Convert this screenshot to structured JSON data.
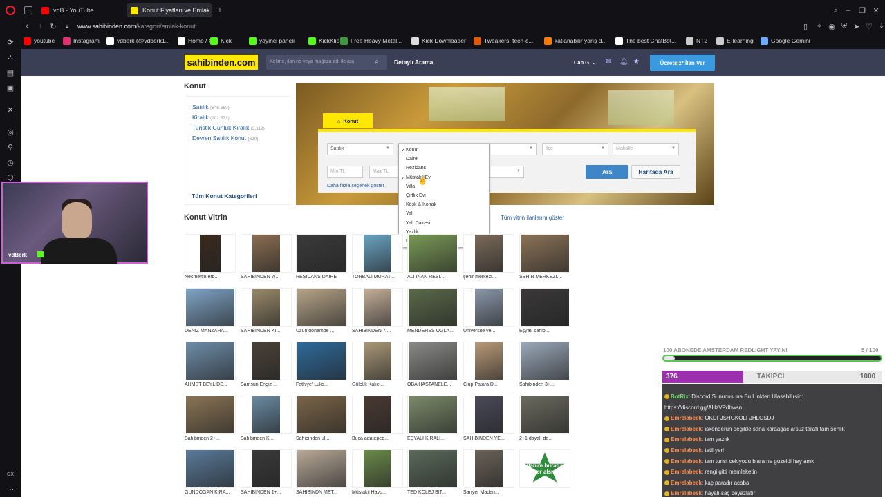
{
  "browser": {
    "tabs": [
      {
        "label": "vdB - YouTube"
      },
      {
        "label": "Konut Fiyatları ve Emlak İla"
      }
    ],
    "new_tab": "+",
    "url_host": "www.sahibinden.com",
    "url_path": "/kategori/emlak-konut",
    "bookmarks": [
      {
        "label": "youtube",
        "icon": "youtube-icon",
        "color": "#ff0000"
      },
      {
        "label": "Instagram",
        "icon": "instagram-icon",
        "color": "#e1306c"
      },
      {
        "label": "vdberk (@vdberk1...",
        "icon": "tiktok-icon",
        "color": "#ffffff"
      },
      {
        "label": "Home / X",
        "icon": "x-icon",
        "color": "#ffffff"
      },
      {
        "label": "Kick",
        "icon": "kick-icon",
        "color": "#53fc18"
      },
      {
        "label": "yayinci paneli",
        "icon": "kick-icon",
        "color": "#53fc18"
      },
      {
        "label": "KickKlip",
        "icon": "kick-icon",
        "color": "#53fc18"
      },
      {
        "label": "Free Heavy Metal...",
        "icon": "music-icon",
        "color": "#3c9a3c"
      },
      {
        "label": "Kick Downloader",
        "icon": "download-icon",
        "color": "#dddddd"
      },
      {
        "label": "Tweakers: tech-c...",
        "icon": "tweakers-icon",
        "color": "#e05a00"
      },
      {
        "label": "katlanabilir yarış d...",
        "icon": "shop-icon",
        "color": "#ff7a00"
      },
      {
        "label": "The best ChatBot...",
        "icon": "chatgpt-icon",
        "color": "#ffffff"
      },
      {
        "label": "NT2",
        "icon": "doc-icon",
        "color": "#cccccc"
      },
      {
        "label": "E-learning",
        "icon": "doc-icon",
        "color": "#cccccc"
      },
      {
        "label": "Google Gemini",
        "icon": "gemini-icon",
        "color": "#6aa9ff"
      }
    ]
  },
  "site": {
    "logo": "sahibinden.com",
    "search_placeholder": "Kelime, ilan no veya mağaza adı ile ara",
    "detailed_search": "Detaylı Arama",
    "user": "Can G.",
    "post_ad": "Ücretsiz* İlan Ver",
    "accent": "#ffe800",
    "header_bg": "#3a3f55"
  },
  "konut": {
    "title": "Konut",
    "categories": [
      {
        "label": "Satılık",
        "count": "(646.660)"
      },
      {
        "label": "Kiralık",
        "count": "(202.571)"
      },
      {
        "label": "Turistik Günlük Kiralık",
        "count": "(3.119)"
      },
      {
        "label": "Devren Satılık Konut",
        "count": "(690)"
      }
    ],
    "all_categories": "Tüm Konut Kategorileri"
  },
  "search_form": {
    "tab": "Konut",
    "type_select": "Satılık",
    "ilce": "İlçe",
    "mahalle": "Mahalle",
    "min_tl": "Min TL",
    "max_tl": "Max TL",
    "more_options": "Daha fazla seçenek göster",
    "search": "Ara",
    "map_search": "Haritada Ara",
    "dropdown_options": [
      {
        "label": "Konut",
        "checked": true
      },
      {
        "label": "Daire",
        "checked": false
      },
      {
        "label": "Rezidans",
        "checked": false
      },
      {
        "label": "Müstakil Ev",
        "checked": true
      },
      {
        "label": "Villa",
        "checked": false
      },
      {
        "label": "Çiftlik Evi",
        "checked": false
      },
      {
        "label": "Köşk & Konak",
        "checked": false
      },
      {
        "label": "Yalı",
        "checked": false
      },
      {
        "label": "Yalı Dairesi",
        "checked": false
      },
      {
        "label": "Yazlık",
        "checked": false
      },
      {
        "label": "Kooperatif",
        "checked": false
      }
    ],
    "check_mark": "✓"
  },
  "vitrin": {
    "title": "Konut Vitrin",
    "show_all": "Tüm vitrin ilanlarını göster",
    "rows": [
      [
        "Necmettin erb...",
        "SAHİBİNDEN 7/...",
        "RESİDANS DAİRE",
        "TORBALI MURAT...",
        "ALİ İNAN RESİ...",
        "şehir merkezi...",
        "ŞEHİR MERKEZİ..."
      ],
      [
        "DENİZ MANZARA...",
        "SAHİBİNDEN Kİ...",
        "Uzun donemde ...",
        "SAHİBİNDEN 7/...",
        "MENDERES OĞLA...",
        "Üniversite ve...",
        "Eşyalı sahibi..."
      ],
      [
        "AHMET BEYLİDE...",
        "Samsun Engiz ...",
        "Fethiye' Luks...",
        "Gölcük Kalıcı...",
        "OBA HASTANELE...",
        "Clup Patara D...",
        "Sahibinden 3+..."
      ],
      [
        "Sahibinden 2+...",
        "Sahibinden Ki...",
        "Sahibinden ul...",
        "Buca adateped...",
        "EŞYALI KİRALI...",
        "SAHİBİNDEN YE...",
        "2+1 dayalı do..."
      ],
      [
        "GÜNDOĞAN KİRA...",
        "SAHİBİNDEN 1+...",
        "SAHİBİNDN MET...",
        "Müstakil Havu...",
        "TED KOLEJ BİT...",
        "Sarıyer Maden...",
        ""
      ]
    ],
    "ad_here": "İlanım burada yer alsın"
  },
  "stream": {
    "streamer": "vdBerk",
    "sub_goal": "100 ABONEDE AMSTERDAM REDLIGHT YAYINI",
    "sub_goal_count": "5 / 100",
    "sub_goal_progress": 0.05,
    "followers_current": "376",
    "followers_label": "TAKIPCI",
    "followers_target": "1000",
    "follower_progress": 0.376,
    "chat": [
      {
        "user": "",
        "text": "",
        "partial": true
      },
      {
        "user": "BotRix",
        "text": ": Discord Sunucusuna Bu Linkten Ulasabilirsin:"
      },
      {
        "user": "",
        "text": "https://discord.gg/AHzVPdbwsn"
      },
      {
        "user": "Emrelabeek",
        "text": ": OKDFJSHGKOLFJHLGSDJ"
      },
      {
        "user": "Emrelabeek",
        "text": ": iskenderun degilde sana karaagac arsuz tarafı tam senlik"
      },
      {
        "user": "Emrelabeek",
        "text": ": tam yazlık"
      },
      {
        "user": "Emrelabeek",
        "text": ": tatil yeri"
      },
      {
        "user": "Emrelabeek",
        "text": ": tam turist cekiyodu biara ne guzeldi hay amk"
      },
      {
        "user": "Emrelabeek",
        "text": ": rengi gitti memleketin"
      },
      {
        "user": "Emrelabeek",
        "text": ": kaç paradır acaba"
      },
      {
        "user": "Emrelabeek",
        "text": ": hayalı saç beyazlatır"
      }
    ]
  }
}
